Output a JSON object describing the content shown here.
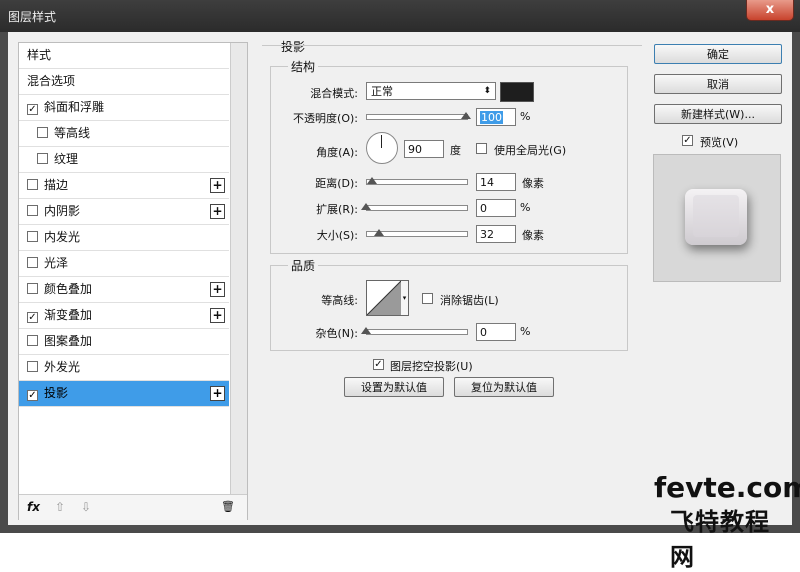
{
  "window": {
    "title": "图层样式",
    "close": "x"
  },
  "left_list": {
    "items": [
      {
        "label": "样式",
        "checkbox": false,
        "checked": false,
        "indent": false,
        "plus": false,
        "selected": false
      },
      {
        "label": "混合选项",
        "checkbox": false,
        "checked": false,
        "indent": false,
        "plus": false,
        "selected": false
      },
      {
        "label": "斜面和浮雕",
        "checkbox": true,
        "checked": true,
        "indent": false,
        "plus": false,
        "selected": false
      },
      {
        "label": "等高线",
        "checkbox": true,
        "checked": false,
        "indent": true,
        "plus": false,
        "selected": false
      },
      {
        "label": "纹理",
        "checkbox": true,
        "checked": false,
        "indent": true,
        "plus": false,
        "selected": false
      },
      {
        "label": "描边",
        "checkbox": true,
        "checked": false,
        "indent": false,
        "plus": true,
        "selected": false
      },
      {
        "label": "内阴影",
        "checkbox": true,
        "checked": false,
        "indent": false,
        "plus": true,
        "selected": false
      },
      {
        "label": "内发光",
        "checkbox": true,
        "checked": false,
        "indent": false,
        "plus": false,
        "selected": false
      },
      {
        "label": "光泽",
        "checkbox": true,
        "checked": false,
        "indent": false,
        "plus": false,
        "selected": false
      },
      {
        "label": "颜色叠加",
        "checkbox": true,
        "checked": false,
        "indent": false,
        "plus": true,
        "selected": false
      },
      {
        "label": "渐变叠加",
        "checkbox": true,
        "checked": true,
        "indent": false,
        "plus": true,
        "selected": false
      },
      {
        "label": "图案叠加",
        "checkbox": true,
        "checked": false,
        "indent": false,
        "plus": false,
        "selected": false
      },
      {
        "label": "外发光",
        "checkbox": true,
        "checked": false,
        "indent": false,
        "plus": false,
        "selected": false
      },
      {
        "label": "投影",
        "checkbox": true,
        "checked": true,
        "indent": false,
        "plus": true,
        "selected": true
      }
    ],
    "bottom": {
      "fx": "fx",
      "up": "⇧",
      "down": "⇩",
      "trash": "🗑"
    }
  },
  "drop_shadow": {
    "section_title": "投影",
    "structure": {
      "title": "结构",
      "blend_mode_label": "混合模式:",
      "blend_mode_value": "正常",
      "opacity_label": "不透明度(O):",
      "opacity_value": "100",
      "opacity_slider": 100,
      "angle_label": "角度(A):",
      "angle_value": "90",
      "angle_unit": "度",
      "global_light_label": "使用全局光(G)",
      "distance_label": "距离(D):",
      "distance_value": "14",
      "distance_unit": "像素",
      "distance_slider": 0.06,
      "spread_label": "扩展(R):",
      "spread_value": "0",
      "spread_slider": 0,
      "size_label": "大小(S):",
      "size_value": "32",
      "size_unit": "像素",
      "size_slider": 0.13,
      "percent": "%"
    },
    "quality": {
      "title": "品质",
      "contour_label": "等高线:",
      "antialias_label": "消除锯齿(L)",
      "noise_label": "杂色(N):",
      "noise_value": "0",
      "noise_slider": 0,
      "percent": "%"
    },
    "knockout_label": "图层挖空投影(U)",
    "set_default": "设置为默认值",
    "reset_default": "复位为默认值"
  },
  "right": {
    "ok": "确定",
    "cancel": "取消",
    "new_style": "新建样式(W)...",
    "preview_label": "预览(V)"
  },
  "watermark": {
    "line1": "fevte.com",
    "line2": "飞特教程网"
  },
  "colors": {
    "selection": "#3f9ce8",
    "shadow_swatch": "#1e1e1e"
  }
}
